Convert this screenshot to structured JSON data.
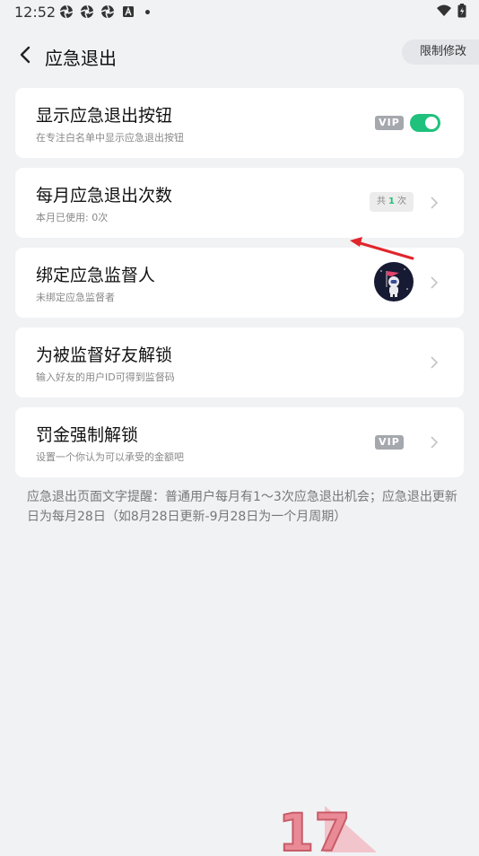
{
  "status_bar": {
    "time": "12:52",
    "icons": [
      "aperture-icon",
      "aperture-icon",
      "aperture-icon",
      "a-badge-icon",
      "dot-icon"
    ],
    "right_icons": [
      "wifi-icon",
      "battery-charging-icon"
    ]
  },
  "header": {
    "title": "应急退出",
    "back_icon": "chevron-left-icon",
    "limit_button": "限制修改"
  },
  "cards": [
    {
      "title": "显示应急退出按钮",
      "subtitle": "在专注白名单中显示应急退出按钮",
      "vip": "VIP",
      "toggle_on": true
    },
    {
      "title": "每月应急退出次数",
      "subtitle": "本月已使用: 0次",
      "badge_prefix": "共",
      "badge_count": "1",
      "badge_suffix": "次"
    },
    {
      "title": "绑定应急监督人",
      "subtitle": "未绑定应急监督者",
      "avatar": "astronaut-avatar"
    },
    {
      "title": "为被监督好友解锁",
      "subtitle": "输入好友的用户ID可得到监督码"
    },
    {
      "title": "罚金强制解锁",
      "subtitle": "设置一个你认为可以承受的金额吧",
      "vip": "VIP"
    }
  ],
  "note": "应急退出页面文字提醒：普通用户每月有1～3次应急退出机会；应急退出更新日为每月28日（如8月28日更新-9月28日为一个月周期）",
  "watermark": "17",
  "colors": {
    "background": "#f1f2f4",
    "accent_green": "#1fc17c",
    "vip_gray": "#a5a8ad",
    "annotation_red": "#e0262b"
  }
}
